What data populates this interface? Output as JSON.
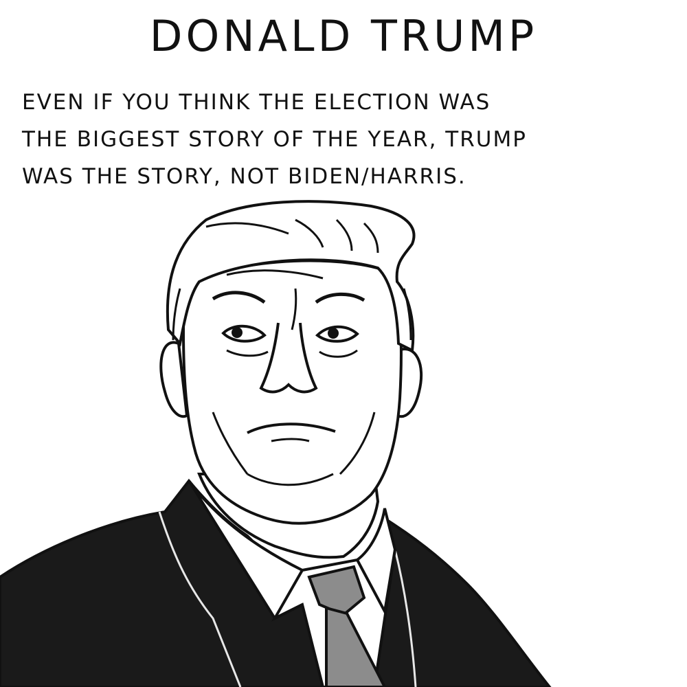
{
  "comic": {
    "title": "DONALD TRUMP",
    "caption_lines": [
      "EVEN IF YOU THINK THE ELECTION WAS",
      "THE BIGGEST STORY OF THE YEAR, TRUMP",
      "WAS THE STORY, NOT  BIDEN/HARRIS."
    ]
  },
  "colors": {
    "ink": "#111111",
    "paper": "#ffffff",
    "suit": "#1a1a1a",
    "tie": "#8c8c8c"
  }
}
